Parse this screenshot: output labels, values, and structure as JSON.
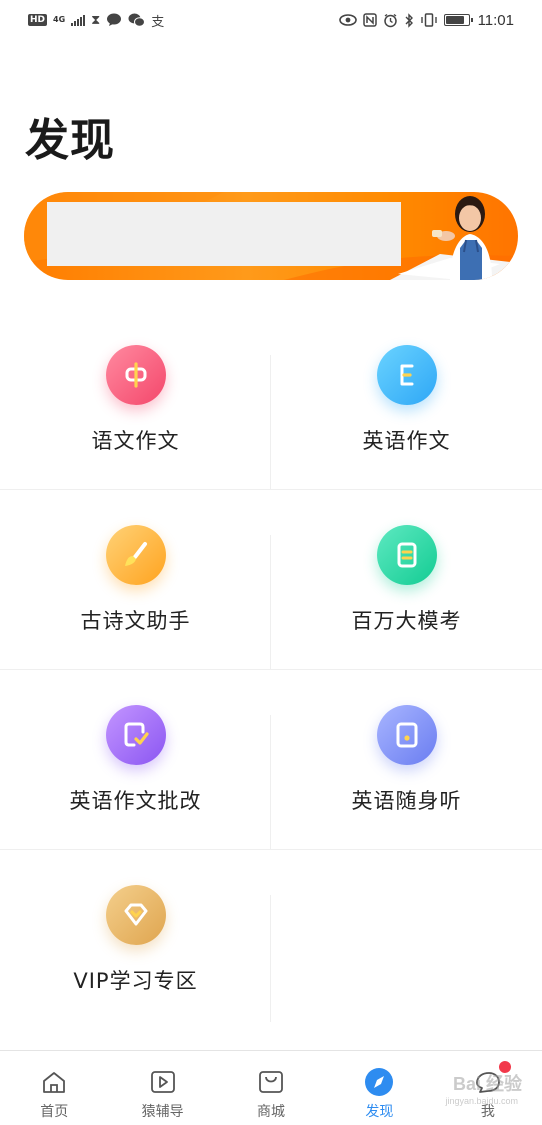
{
  "status_bar": {
    "hd": "HD",
    "network": "4G",
    "time": "11:01",
    "battery_level": 0.85,
    "left_icons": [
      "hourglass-icon",
      "chat-bubble-icon",
      "wechat-icon",
      "alipay-icon"
    ],
    "right_icons": [
      "eye-icon",
      "nfc-icon",
      "alarm-icon",
      "bluetooth-icon",
      "vibrate-icon",
      "battery-icon"
    ]
  },
  "page": {
    "title": "发现"
  },
  "banner": {
    "colors": {
      "start": "#ff7d00",
      "end": "#ff7400"
    }
  },
  "features": [
    {
      "label": "语文作文",
      "icon": "chinese-character-icon",
      "color_from": "#ff8aa0",
      "color_to": "#f4476b"
    },
    {
      "label": "英语作文",
      "icon": "letter-e-icon",
      "color_from": "#6ad3ff",
      "color_to": "#2ea7f6"
    },
    {
      "label": "古诗文助手",
      "icon": "brush-icon",
      "color_from": "#ffd277",
      "color_to": "#ffa31f"
    },
    {
      "label": "百万大模考",
      "icon": "exam-paper-icon",
      "color_from": "#5ee9c1",
      "color_to": "#13cc93"
    },
    {
      "label": "英语作文批改",
      "icon": "check-document-icon",
      "color_from": "#c395ff",
      "color_to": "#8b56f2"
    },
    {
      "label": "英语随身听",
      "icon": "player-icon",
      "color_from": "#a8b5ff",
      "color_to": "#6a7df1"
    },
    {
      "label": "VIP学习专区",
      "icon": "diamond-icon",
      "color_from": "#f4cf8c",
      "color_to": "#dfa54f"
    }
  ],
  "bottom_nav": {
    "active": "发现",
    "items": [
      {
        "label": "首页",
        "icon": "home-icon"
      },
      {
        "label": "猿辅导",
        "icon": "play-icon"
      },
      {
        "label": "商城",
        "icon": "shopping-bag-icon"
      },
      {
        "label": "发现",
        "icon": "compass-icon"
      },
      {
        "label": "我",
        "icon": "profile-icon"
      }
    ]
  },
  "watermark": {
    "text": "Bai 经验",
    "sub": "jingyan.baidu.com"
  }
}
